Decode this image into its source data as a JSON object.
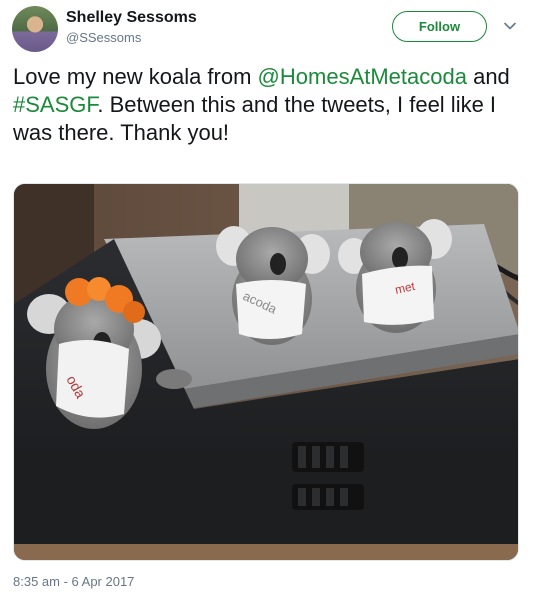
{
  "user": {
    "name": "Shelley Sessoms",
    "handle": "@SSessoms"
  },
  "follow_button": {
    "label": "Follow"
  },
  "tweet": {
    "text_1": "Love my new koala from ",
    "mention": "@HomesAtMetacoda",
    "text_2": " and ",
    "hashtag": "#SASGF",
    "text_3": ". Between this and the tweets, I feel like I was there. Thank you!",
    "timestamp": "8:35 am - 6 Apr 2017"
  },
  "photo": {
    "tag_left": "oda",
    "tag_middle": "acoda",
    "tag_right": "met"
  },
  "colors": {
    "accent": "#1b8a3a",
    "secondary_text": "#657786"
  },
  "icons": {
    "menu": "chevron-down-icon"
  }
}
